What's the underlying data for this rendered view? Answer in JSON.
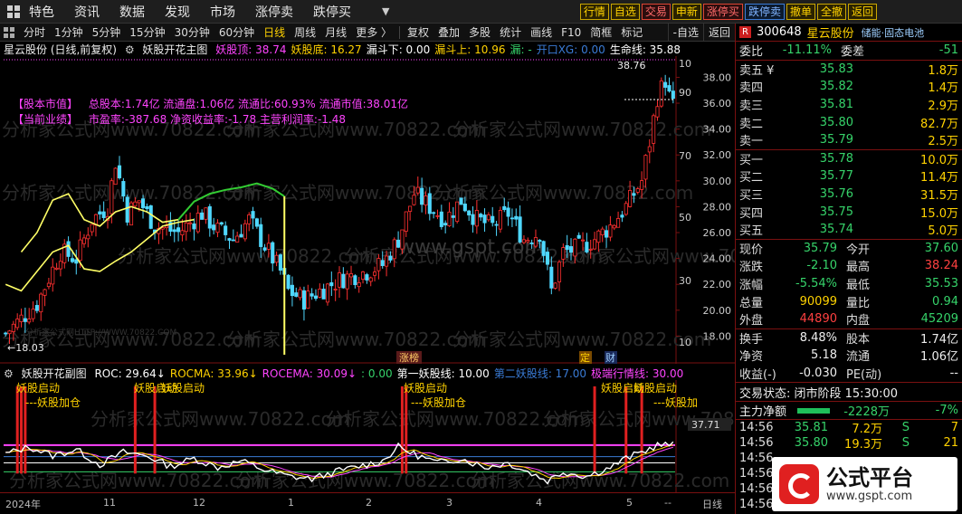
{
  "menubar": {
    "items": [
      "特色",
      "资讯",
      "数据",
      "发现",
      "市场",
      "涨停卖",
      "跌停买"
    ],
    "right_buttons": [
      {
        "label": "行情",
        "style": "yellow"
      },
      {
        "label": "自选",
        "style": "yellow"
      },
      {
        "label": "交易",
        "style": "red"
      },
      {
        "label": "申新",
        "style": "yellow"
      },
      {
        "label": "涨停买",
        "style": "red"
      },
      {
        "label": "跌停卖",
        "style": "blue"
      },
      {
        "label": "撤单",
        "style": "yellow"
      },
      {
        "label": "全撤",
        "style": "yellow"
      },
      {
        "label": "返回",
        "style": "yellow"
      }
    ]
  },
  "toolbar": {
    "periods": [
      "分时",
      "1分钟",
      "5分钟",
      "15分钟",
      "30分钟",
      "60分钟",
      "日线",
      "周线",
      "月线",
      "更多 〉"
    ],
    "active_period": "日线",
    "tools": [
      "复权",
      "叠加",
      "多股",
      "统计",
      "画线",
      "F10",
      "简框",
      "标记"
    ],
    "right": [
      "-自选",
      "返回"
    ]
  },
  "main_header": {
    "title": "星云股份 (日线,前复权)",
    "indicator_name": "妖股开花主图",
    "items": [
      {
        "text": "妖股顶: 38.74",
        "color": "#ff44ff"
      },
      {
        "text": "妖股底: 16.27",
        "color": "#ffd200"
      },
      {
        "text": "漏斗下: 0.00",
        "color": "#ffffff"
      },
      {
        "text": "漏斗上: 10.96",
        "color": "#ffd200"
      },
      {
        "text": "漏: -",
        "color": "#36d36a"
      },
      {
        "text": "开口XG: 0.00",
        "color": "#3a7bd5"
      },
      {
        "text": "生命线: 35.88",
        "color": "#ffffff"
      }
    ]
  },
  "info": {
    "line1_label": "【股本市值】",
    "line1": "总股本:1.74亿 流通盘:1.06亿 流通比:60.93% 流通市值:38.01亿",
    "line2_label": "【当前业绩】",
    "line2": "市盈率:-387.68 净资收益率:-1.78 主营利润率:-1.48"
  },
  "watermarks": {
    "site1": "分析家公式网www.70822.com",
    "site2": "www.gspt.com",
    "small": "分析家公式网HTTP://WWW.70822.COM"
  },
  "main_chart_labels": {
    "high_marker": "38.76",
    "low_marker": "18.03",
    "event_zhangbang": "涨榜",
    "event_ding": "定",
    "event_cai": "财",
    "right_pct_labels": [
      "10",
      "90",
      "70",
      "50",
      "30",
      "10"
    ]
  },
  "sub_header": {
    "indicator_name": "妖股开花副图",
    "items": [
      {
        "text": "ROC: 29.64↓",
        "color": "#ffffff"
      },
      {
        "text": "ROCMA: 33.96↓",
        "color": "#ffd200"
      },
      {
        "text": "ROCEMA: 30.09↓",
        "color": "#ff44ff"
      },
      {
        "text": ": 0.00",
        "color": "#36d36a"
      },
      {
        "text": "第一妖股线: 10.00",
        "color": "#ffffff"
      },
      {
        "text": "第二妖股线: 17.00",
        "color": "#3a7bd5"
      },
      {
        "text": "极端行情线: 30.00",
        "color": "#ff44ff"
      }
    ]
  },
  "sub_chart_labels": {
    "signal1": "妖股启动",
    "signal2": "妖股启动",
    "signal3": "妖股启动",
    "signal4": "妖股启动",
    "signal5": "妖股启动",
    "add1": "---妖股加仓",
    "add2": "---妖股加仓",
    "add3": "---妖股加",
    "value_tag": "37.71"
  },
  "time_axis": {
    "labels": [
      "2024年",
      "11",
      "12",
      "1",
      "2",
      "3",
      "4",
      "5",
      "--",
      "日线"
    ]
  },
  "stock": {
    "code": "300648",
    "name": "星云股份",
    "tag": "储能·固态电池",
    "weibi_label": "委比",
    "weibi": "-11.11%",
    "weicha_label": "委差",
    "weicha": "-51",
    "asks": [
      {
        "label": "卖五 ¥",
        "price": "35.83",
        "vol": "1.8万"
      },
      {
        "label": "卖四",
        "price": "35.82",
        "vol": "1.4万"
      },
      {
        "label": "卖三",
        "price": "35.81",
        "vol": "2.9万"
      },
      {
        "label": "卖二",
        "price": "35.80",
        "vol": "82.7万"
      },
      {
        "label": "卖一",
        "price": "35.79",
        "vol": "2.5万"
      }
    ],
    "bids": [
      {
        "label": "买一",
        "price": "35.78",
        "vol": "10.0万"
      },
      {
        "label": "买二",
        "price": "35.77",
        "vol": "11.4万"
      },
      {
        "label": "买三",
        "price": "35.76",
        "vol": "31.5万"
      },
      {
        "label": "买四",
        "price": "35.75",
        "vol": "15.0万"
      },
      {
        "label": "买五",
        "price": "35.74",
        "vol": "5.0万"
      }
    ],
    "quote": [
      {
        "l1": "现价",
        "v1": "35.79",
        "c1": "green",
        "l2": "今开",
        "v2": "37.60",
        "c2": "green"
      },
      {
        "l1": "涨跌",
        "v1": "-2.10",
        "c1": "green",
        "l2": "最高",
        "v2": "38.24",
        "c2": "red"
      },
      {
        "l1": "涨幅",
        "v1": "-5.54%",
        "c1": "green",
        "l2": "最低",
        "v2": "35.53",
        "c2": "green"
      },
      {
        "l1": "总量",
        "v1": "90099",
        "c1": "yellow",
        "l2": "量比",
        "v2": "0.94",
        "c2": "green"
      },
      {
        "l1": "外盘",
        "v1": "44890",
        "c1": "red",
        "l2": "内盘",
        "v2": "45209",
        "c2": "green"
      }
    ],
    "fundamentals": [
      {
        "l1": "换手",
        "v1": "8.48%",
        "l2": "股本",
        "v2": "1.74亿"
      },
      {
        "l1": "净资",
        "v1": "5.18",
        "l2": "流通",
        "v2": "1.06亿"
      },
      {
        "l1": "收益(-)",
        "v1": "-0.030",
        "l2": "PE(动)",
        "v2": "--"
      }
    ],
    "trade_status": "交易状态: 闭市阶段 15:30:00",
    "net_flow_label": "主力净额",
    "net_flow_value": "-2228万",
    "net_flow_pct": "-7%",
    "ticks": [
      {
        "time": "14:56",
        "price": "35.81",
        "vol": "7.2万",
        "side": "S",
        "num": "7"
      },
      {
        "time": "14:56",
        "price": "35.80",
        "vol": "19.3万",
        "side": "S",
        "num": "21"
      },
      {
        "time": "14:56",
        "price": "",
        "vol": "",
        "side": "",
        "num": ""
      },
      {
        "time": "14:56",
        "price": "",
        "vol": "",
        "side": "",
        "num": ""
      },
      {
        "time": "14:56",
        "price": "",
        "vol": "",
        "side": "",
        "num": ""
      },
      {
        "time": "14:56",
        "price": "",
        "vol": "",
        "side": "",
        "num": ""
      }
    ]
  },
  "logo": {
    "title": "公式平台",
    "url": "www.gspt.com"
  },
  "chart_data": {
    "type": "candlestick",
    "price_axis": {
      "min": 16,
      "max": 39.5,
      "ticks": [
        38.0,
        36.0,
        34.0,
        32.0,
        30.0,
        28.0,
        26.0,
        24.0,
        22.0,
        20.0,
        18.0
      ]
    },
    "anchors": [
      [
        0,
        18.2
      ],
      [
        8,
        20.5
      ],
      [
        14,
        24.5
      ],
      [
        18,
        24.0
      ],
      [
        22,
        27.0
      ],
      [
        26,
        28.0
      ],
      [
        28,
        31.5
      ],
      [
        31,
        27.5
      ],
      [
        34,
        28.5
      ],
      [
        38,
        26.5
      ],
      [
        44,
        26.0
      ],
      [
        50,
        27.5
      ],
      [
        54,
        26.2
      ],
      [
        58,
        25.5
      ],
      [
        62,
        27.0
      ],
      [
        66,
        25.0
      ],
      [
        70,
        23.0
      ],
      [
        72,
        21.5
      ],
      [
        76,
        20.8
      ],
      [
        80,
        21.5
      ],
      [
        86,
        22.5
      ],
      [
        92,
        23.0
      ],
      [
        96,
        23.5
      ],
      [
        100,
        25.5
      ],
      [
        104,
        29.0
      ],
      [
        108,
        28.0
      ],
      [
        112,
        27.0
      ],
      [
        116,
        28.5
      ],
      [
        120,
        27.0
      ],
      [
        124,
        26.5
      ],
      [
        128,
        27.5
      ],
      [
        132,
        25.5
      ],
      [
        136,
        26.0
      ],
      [
        139,
        21.5
      ],
      [
        142,
        24.5
      ],
      [
        146,
        24.8
      ],
      [
        150,
        25.5
      ],
      [
        154,
        26.5
      ],
      [
        158,
        28.0
      ],
      [
        162,
        30.0
      ],
      [
        164,
        33.0
      ],
      [
        166,
        36.5
      ],
      [
        168,
        37.8
      ],
      [
        169,
        36.5
      ],
      [
        170,
        35.8
      ]
    ],
    "support_line": [
      [
        0,
        22
      ],
      [
        4,
        21.5
      ],
      [
        8,
        23.0
      ],
      [
        12,
        24.5
      ],
      [
        16,
        25.0
      ],
      [
        20,
        23.2
      ],
      [
        24,
        23.0
      ],
      [
        28,
        23.8
      ],
      [
        32,
        24.5
      ],
      [
        36,
        25.5
      ],
      [
        40,
        26.5
      ],
      [
        44,
        26.8
      ],
      [
        48,
        27.0
      ]
    ],
    "upper_line_a": [
      [
        4,
        24.5
      ],
      [
        8,
        26.0
      ],
      [
        12,
        28.5
      ],
      [
        16,
        29.0
      ],
      [
        20,
        27.0
      ],
      [
        24,
        26.5
      ],
      [
        28,
        27.6
      ],
      [
        32,
        28.0
      ],
      [
        36,
        27.6
      ],
      [
        40,
        26.8
      ],
      [
        44,
        27.0
      ]
    ],
    "life_line": [
      [
        44,
        27.0
      ],
      [
        48,
        28.4
      ],
      [
        52,
        29.0
      ],
      [
        56,
        29.3
      ],
      [
        60,
        29.5
      ],
      [
        64,
        29.8
      ],
      [
        68,
        29.4
      ],
      [
        71,
        28.8
      ]
    ],
    "sub_axis": {
      "min": -20,
      "max": 100
    },
    "roc_anchors": [
      [
        0,
        20
      ],
      [
        6,
        28
      ],
      [
        12,
        18
      ],
      [
        18,
        25
      ],
      [
        24,
        8
      ],
      [
        30,
        22
      ],
      [
        36,
        18
      ],
      [
        42,
        6
      ],
      [
        48,
        15
      ],
      [
        54,
        5
      ],
      [
        60,
        12
      ],
      [
        66,
        2
      ],
      [
        72,
        -5
      ],
      [
        78,
        -8
      ],
      [
        84,
        0
      ],
      [
        90,
        6
      ],
      [
        96,
        12
      ],
      [
        100,
        28
      ],
      [
        104,
        20
      ],
      [
        110,
        10
      ],
      [
        116,
        15
      ],
      [
        122,
        5
      ],
      [
        128,
        10
      ],
      [
        134,
        -2
      ],
      [
        138,
        -10
      ],
      [
        142,
        0
      ],
      [
        148,
        -5
      ],
      [
        154,
        5
      ],
      [
        158,
        15
      ],
      [
        162,
        22
      ],
      [
        166,
        30
      ],
      [
        170,
        30
      ]
    ],
    "signal_bars": [
      3,
      4,
      5,
      33,
      38,
      101,
      102,
      150,
      158,
      162
    ],
    "reference_lines": [
      {
        "value": 30,
        "color": "#ff44ff"
      },
      {
        "value": 17,
        "color": "#3a7bd5"
      },
      {
        "value": 10,
        "color": "#ffffff"
      },
      {
        "value": 0,
        "color": "#36d36a"
      }
    ]
  }
}
